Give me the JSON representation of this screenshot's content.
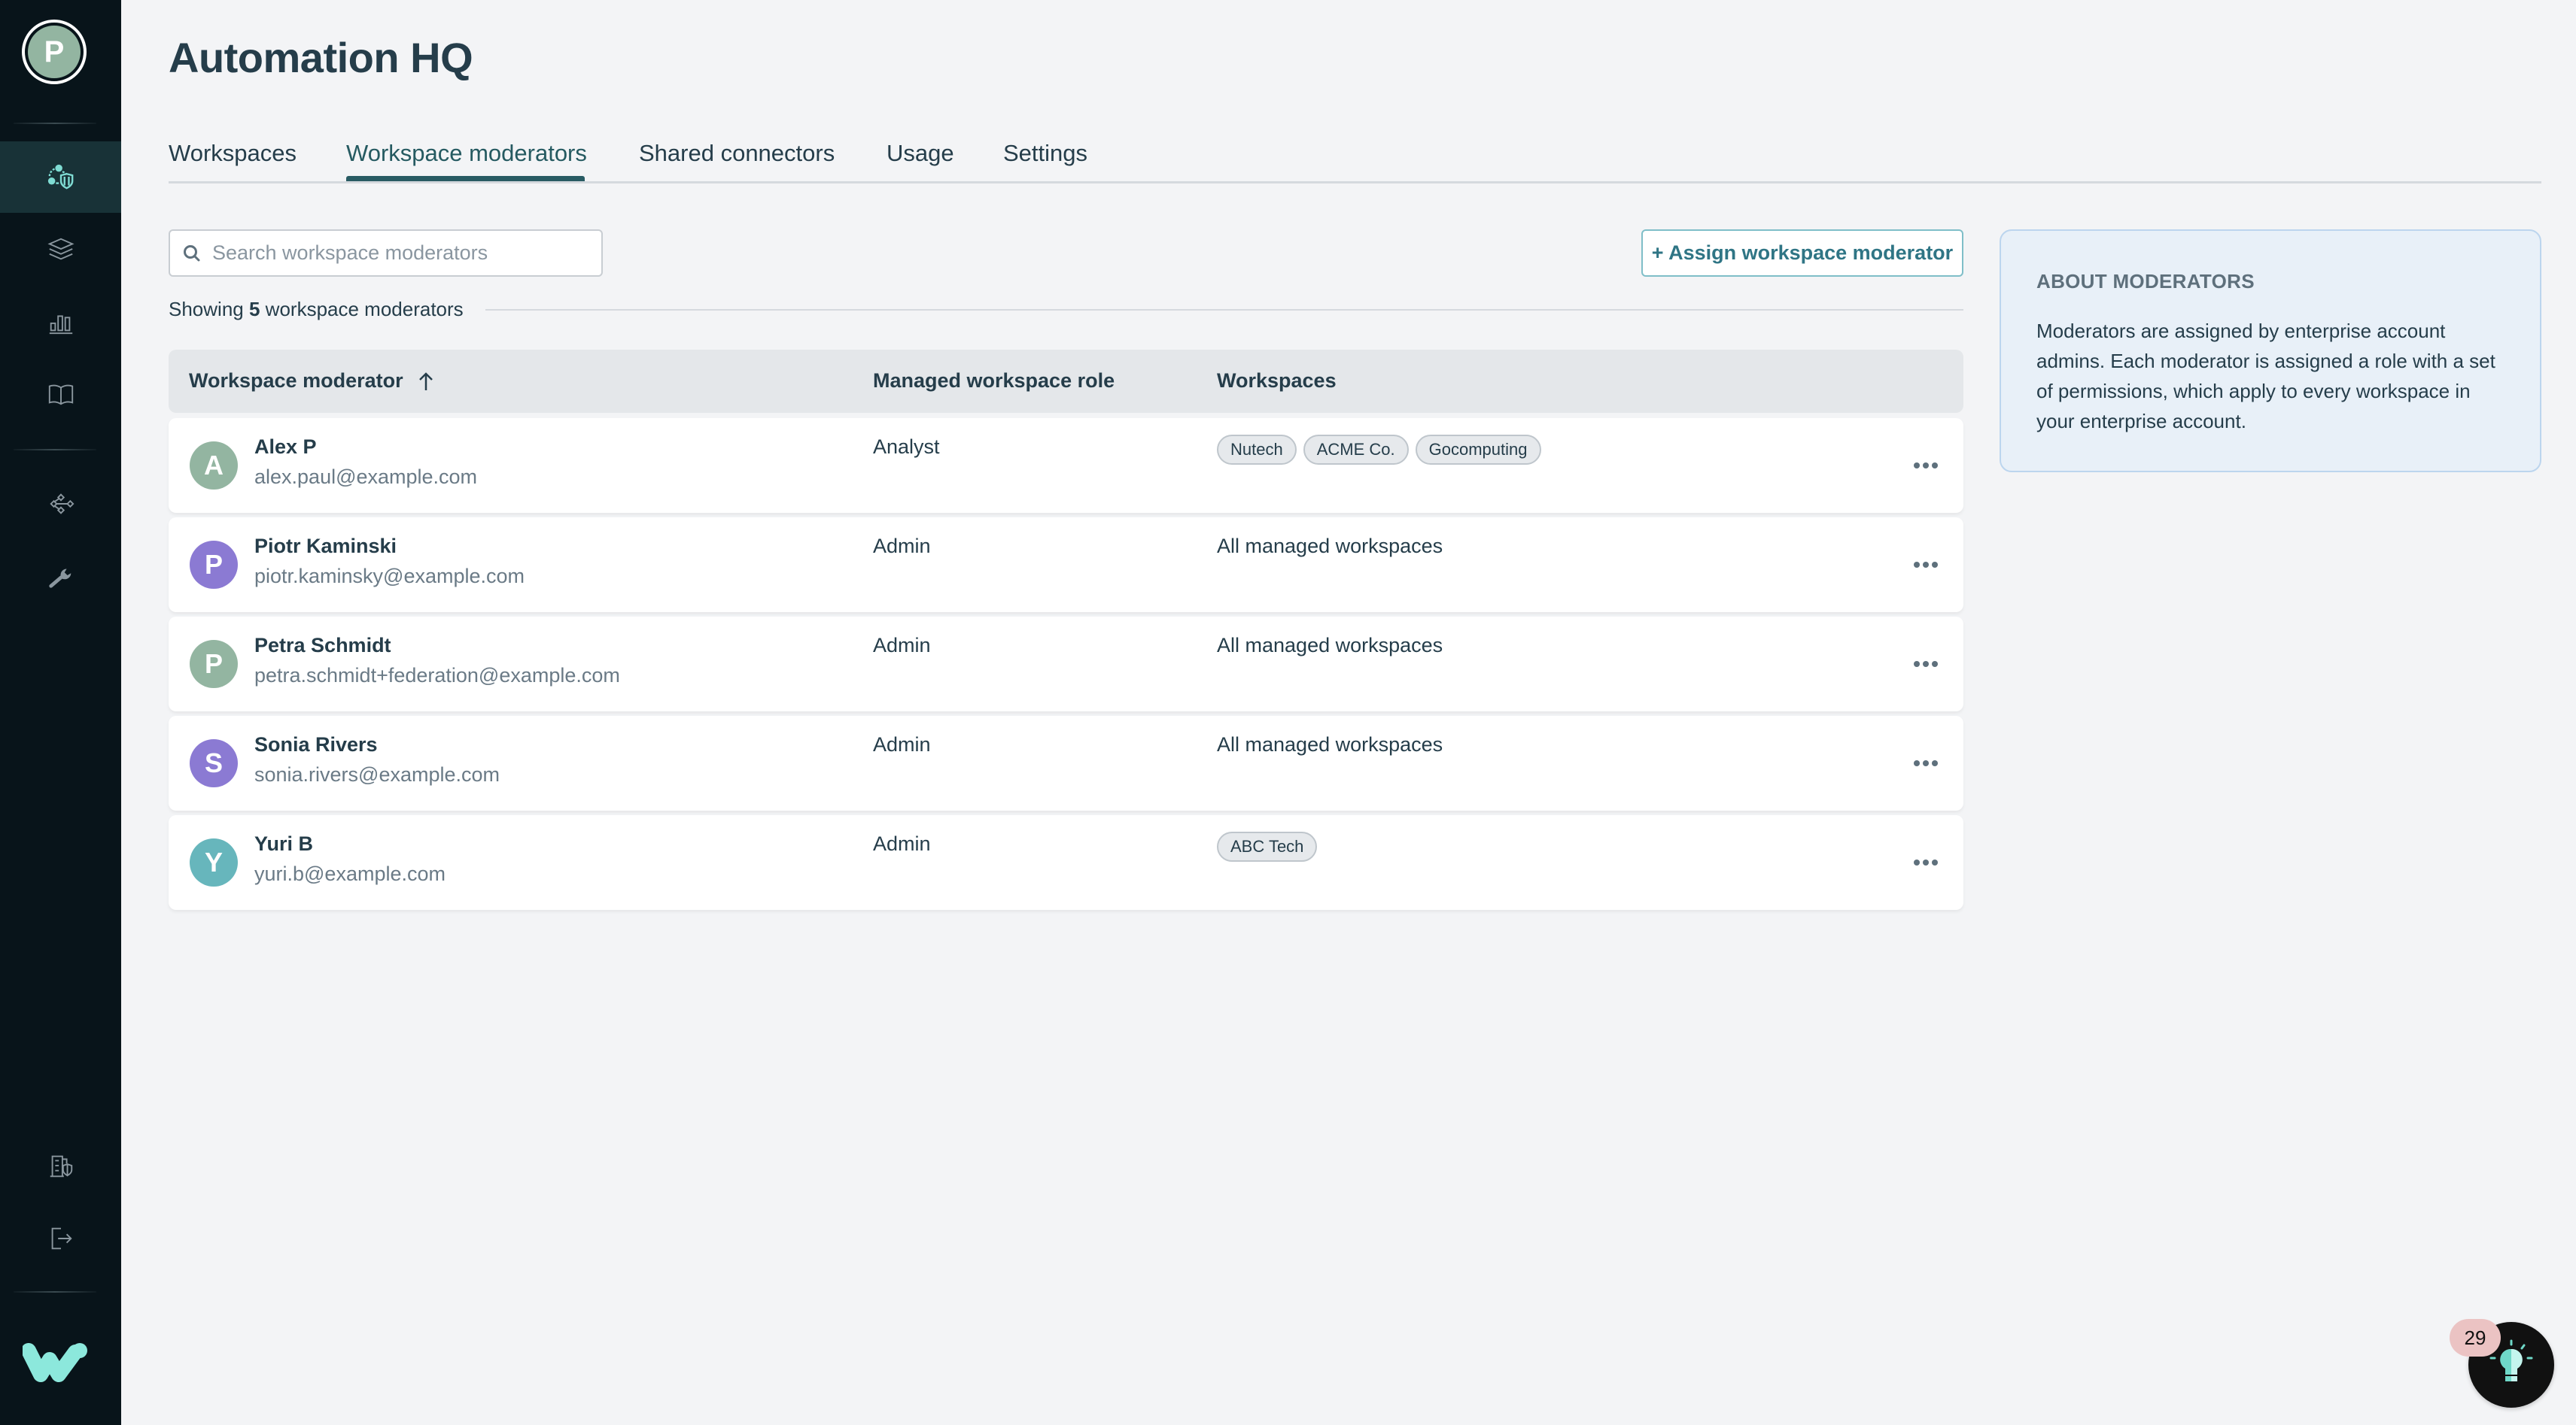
{
  "sidebar": {
    "user_initial": "P",
    "user_avatar_color": "#93b5a1",
    "items": [
      {
        "icon": "moderators-shield-icon",
        "active": true
      },
      {
        "icon": "layers-icon",
        "active": false
      },
      {
        "icon": "bar-chart-icon",
        "active": false
      },
      {
        "icon": "book-icon",
        "active": false
      },
      {
        "icon": "connections-icon",
        "active": false
      },
      {
        "icon": "wrench-icon",
        "active": false
      }
    ],
    "bottom_items": [
      {
        "icon": "building-shield-icon"
      },
      {
        "icon": "logout-icon"
      }
    ],
    "logo": "w-logo-icon",
    "accent_color": "#8ce8dc"
  },
  "header": {
    "title": "Automation HQ"
  },
  "tabs": [
    {
      "label": "Workspaces",
      "active": false
    },
    {
      "label": "Workspace moderators",
      "active": true
    },
    {
      "label": "Shared connectors",
      "active": false
    },
    {
      "label": "Usage",
      "active": false
    },
    {
      "label": "Settings",
      "active": false
    }
  ],
  "search": {
    "placeholder": "Search workspace moderators",
    "value": ""
  },
  "assign_button": {
    "label": "+ Assign workspace moderator"
  },
  "summary": {
    "prefix": "Showing",
    "count": "5",
    "suffix": "workspace moderators"
  },
  "table": {
    "columns": [
      {
        "label": "Workspace moderator",
        "sort": "ascending"
      },
      {
        "label": "Managed workspace role"
      },
      {
        "label": "Workspaces"
      }
    ],
    "rows": [
      {
        "initial": "A",
        "avatar_color": "#93b5a1",
        "name": "Alex P",
        "email": "alex.paul@example.com",
        "role": "Analyst",
        "workspaces": [
          "Nutech",
          "ACME Co.",
          "Gocomputing"
        ],
        "workspaces_text": null
      },
      {
        "initial": "P",
        "avatar_color": "#8b7ad3",
        "name": "Piotr Kaminski",
        "email": "piotr.kaminsky@example.com",
        "role": "Admin",
        "workspaces": [],
        "workspaces_text": "All managed workspaces"
      },
      {
        "initial": "P",
        "avatar_color": "#93b5a1",
        "name": "Petra Schmidt",
        "email": "petra.schmidt+federation@example.com",
        "role": "Admin",
        "workspaces": [],
        "workspaces_text": "All managed workspaces"
      },
      {
        "initial": "S",
        "avatar_color": "#8b7ad3",
        "name": "Sonia Rivers",
        "email": "sonia.rivers@example.com",
        "role": "Admin",
        "workspaces": [],
        "workspaces_text": "All managed workspaces"
      },
      {
        "initial": "Y",
        "avatar_color": "#67b6bc",
        "name": "Yuri B",
        "email": "yuri.b@example.com",
        "role": "Admin",
        "workspaces": [
          "ABC Tech"
        ],
        "workspaces_text": null
      }
    ]
  },
  "info_panel": {
    "heading": "ABOUT MODERATORS",
    "body": "Moderators are assigned by enterprise account admins. Each moderator is assigned a role with a set of permissions, which apply to every workspace in your enterprise account."
  },
  "help": {
    "icon": "lightbulb-icon",
    "badge_count": "29"
  }
}
